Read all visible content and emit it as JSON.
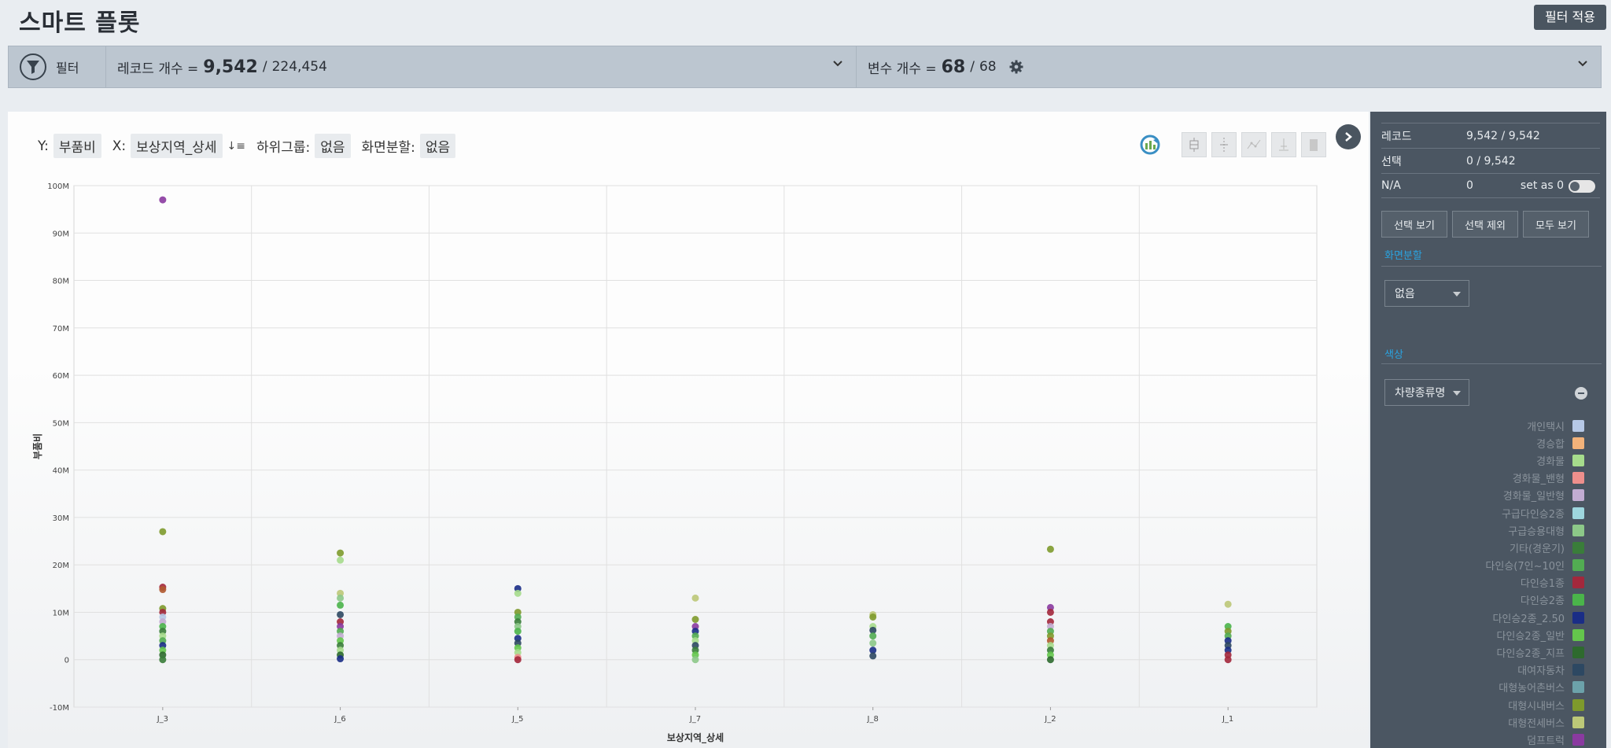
{
  "header": {
    "title": "스마트 플롯",
    "apply_button": "필터 적용"
  },
  "filterbar": {
    "filter_label": "필터",
    "records_label": "레코드 개수 =",
    "records_current": "9,542",
    "records_sep": "/",
    "records_total": "224,454",
    "vars_label": "변수 개수 =",
    "vars_current": "68",
    "vars_sep": "/",
    "vars_total": "68"
  },
  "plot_controls": {
    "y_label": "Y:",
    "y_value": "부품비",
    "x_label": "X:",
    "x_value": "보상지역_상세",
    "subgroup_label": "하위그룹:",
    "subgroup_value": "없음",
    "split_label": "화면분할:",
    "split_value": "없음"
  },
  "side_panel": {
    "rows": [
      {
        "key": "레코드",
        "value": "9,542 / 9,542"
      },
      {
        "key": "선택",
        "value": "0 / 9,542"
      },
      {
        "key": "N/A",
        "value": "0",
        "extra": "set as 0"
      }
    ],
    "buttons": [
      "선택 보기",
      "선택 제외",
      "모두 보기"
    ],
    "split_title": "화면분할",
    "split_value": "없음",
    "color_title": "색상",
    "color_value": "차량종류명",
    "legend": [
      {
        "name": "개인택시",
        "color": "#b6c8e6"
      },
      {
        "name": "경승합",
        "color": "#f2b27a"
      },
      {
        "name": "경화물",
        "color": "#a6dc8c"
      },
      {
        "name": "경화물_밴형",
        "color": "#ee8f8c"
      },
      {
        "name": "경화물_일반형",
        "color": "#c2acd2"
      },
      {
        "name": "구급다인승2종",
        "color": "#9ed6de"
      },
      {
        "name": "구급승용대형",
        "color": "#8cc888"
      },
      {
        "name": "기타(경운기)",
        "color": "#3a7d3a"
      },
      {
        "name": "다인승(7인~10인",
        "color": "#52ac52"
      },
      {
        "name": "다인승1종",
        "color": "#a3283c"
      },
      {
        "name": "다인승2종",
        "color": "#4ab44a"
      },
      {
        "name": "다인승2종_2.50",
        "color": "#1a2d86"
      },
      {
        "name": "다인승2종_일반",
        "color": "#64c64c"
      },
      {
        "name": "다인승2종_지프",
        "color": "#2e6a2e"
      },
      {
        "name": "대여자동차",
        "color": "#2d4862"
      },
      {
        "name": "대형농어촌버스",
        "color": "#6ca2aa"
      },
      {
        "name": "대형시내버스",
        "color": "#7e9a2c"
      },
      {
        "name": "대형전세버스",
        "color": "#bcc878"
      },
      {
        "name": "덤프트럭",
        "color": "#8a3aa0"
      }
    ]
  },
  "chart_data": {
    "type": "scatter",
    "title": "",
    "xlabel": "보상지역_상세",
    "ylabel": "부품비",
    "categories": [
      "J_3",
      "J_6",
      "J_5",
      "J_7",
      "J_8",
      "J_2",
      "J_1"
    ],
    "y_ticks": [
      "100M",
      "90M",
      "80M",
      "70M",
      "60M",
      "50M",
      "40M",
      "30M",
      "20M",
      "10M",
      "0",
      "-10M"
    ],
    "ylim": [
      -10000000,
      100000000
    ],
    "grid": true,
    "points": [
      {
        "x": "J_3",
        "y": 97000000,
        "color": "#8a3aa0"
      },
      {
        "x": "J_3",
        "y": 27000000,
        "color": "#7e9a2c"
      },
      {
        "x": "J_3",
        "y": 15300000,
        "color": "#a3283c"
      },
      {
        "x": "J_3",
        "y": 14800000,
        "color": "#b05a30"
      },
      {
        "x": "J_3",
        "y": 10800000,
        "color": "#7e9a2c"
      },
      {
        "x": "J_3",
        "y": 10000000,
        "color": "#a3283c"
      },
      {
        "x": "J_3",
        "y": 9000000,
        "color": "#b6c8e6"
      },
      {
        "x": "J_3",
        "y": 8000000,
        "color": "#c2acd2"
      },
      {
        "x": "J_3",
        "y": 7000000,
        "color": "#4ab44a"
      },
      {
        "x": "J_3",
        "y": 6000000,
        "color": "#3a7d3a"
      },
      {
        "x": "J_3",
        "y": 5000000,
        "color": "#a6dc8c"
      },
      {
        "x": "J_3",
        "y": 4000000,
        "color": "#52ac52"
      },
      {
        "x": "J_3",
        "y": 3000000,
        "color": "#1a2d86"
      },
      {
        "x": "J_3",
        "y": 2000000,
        "color": "#64c64c"
      },
      {
        "x": "J_3",
        "y": 1000000,
        "color": "#2e6a2e"
      },
      {
        "x": "J_3",
        "y": 0,
        "color": "#3a7d3a"
      },
      {
        "x": "J_6",
        "y": 22500000,
        "color": "#7e9a2c"
      },
      {
        "x": "J_6",
        "y": 21000000,
        "color": "#a6dc8c"
      },
      {
        "x": "J_6",
        "y": 14000000,
        "color": "#bcc878"
      },
      {
        "x": "J_6",
        "y": 13000000,
        "color": "#8cc888"
      },
      {
        "x": "J_6",
        "y": 11500000,
        "color": "#4ab44a"
      },
      {
        "x": "J_6",
        "y": 9500000,
        "color": "#2d4862"
      },
      {
        "x": "J_6",
        "y": 8000000,
        "color": "#a3283c"
      },
      {
        "x": "J_6",
        "y": 7000000,
        "color": "#8a3aa0"
      },
      {
        "x": "J_6",
        "y": 6000000,
        "color": "#52ac52"
      },
      {
        "x": "J_6",
        "y": 5000000,
        "color": "#c2acd2"
      },
      {
        "x": "J_6",
        "y": 4000000,
        "color": "#64c64c"
      },
      {
        "x": "J_6",
        "y": 3000000,
        "color": "#3a7d3a"
      },
      {
        "x": "J_6",
        "y": 2000000,
        "color": "#a6dc8c"
      },
      {
        "x": "J_6",
        "y": 1000000,
        "color": "#2e6a2e"
      },
      {
        "x": "J_6",
        "y": 200000,
        "color": "#1a2d86"
      },
      {
        "x": "J_5",
        "y": 15000000,
        "color": "#1a2d86"
      },
      {
        "x": "J_5",
        "y": 14000000,
        "color": "#a6dc8c"
      },
      {
        "x": "J_5",
        "y": 10000000,
        "color": "#7e9a2c"
      },
      {
        "x": "J_5",
        "y": 9000000,
        "color": "#52ac52"
      },
      {
        "x": "J_5",
        "y": 8000000,
        "color": "#3a7d3a"
      },
      {
        "x": "J_5",
        "y": 7000000,
        "color": "#8cc888"
      },
      {
        "x": "J_5",
        "y": 6000000,
        "color": "#4ab44a"
      },
      {
        "x": "J_5",
        "y": 4500000,
        "color": "#1a2d86"
      },
      {
        "x": "J_5",
        "y": 3500000,
        "color": "#2d4862"
      },
      {
        "x": "J_5",
        "y": 2500000,
        "color": "#64c64c"
      },
      {
        "x": "J_5",
        "y": 1500000,
        "color": "#a6dc8c"
      },
      {
        "x": "J_5",
        "y": 500000,
        "color": "#ee8f8c"
      },
      {
        "x": "J_5",
        "y": 0,
        "color": "#a3283c"
      },
      {
        "x": "J_7",
        "y": 13000000,
        "color": "#bcc878"
      },
      {
        "x": "J_7",
        "y": 8500000,
        "color": "#7e9a2c"
      },
      {
        "x": "J_7",
        "y": 7000000,
        "color": "#8a3aa0"
      },
      {
        "x": "J_7",
        "y": 6000000,
        "color": "#1a2d86"
      },
      {
        "x": "J_7",
        "y": 5000000,
        "color": "#52ac52"
      },
      {
        "x": "J_7",
        "y": 4000000,
        "color": "#a6dc8c"
      },
      {
        "x": "J_7",
        "y": 3000000,
        "color": "#2d4862"
      },
      {
        "x": "J_7",
        "y": 2000000,
        "color": "#3a7d3a"
      },
      {
        "x": "J_7",
        "y": 1000000,
        "color": "#64c64c"
      },
      {
        "x": "J_7",
        "y": 0,
        "color": "#8cc888"
      },
      {
        "x": "J_8",
        "y": 9500000,
        "color": "#bcc878"
      },
      {
        "x": "J_8",
        "y": 9000000,
        "color": "#7e9a2c"
      },
      {
        "x": "J_8",
        "y": 7000000,
        "color": "#a6dc8c"
      },
      {
        "x": "J_8",
        "y": 6200000,
        "color": "#2d4862"
      },
      {
        "x": "J_8",
        "y": 5000000,
        "color": "#52ac52"
      },
      {
        "x": "J_8",
        "y": 3500000,
        "color": "#8cc888"
      },
      {
        "x": "J_8",
        "y": 2000000,
        "color": "#1a2d86"
      },
      {
        "x": "J_8",
        "y": 800000,
        "color": "#2d4862"
      },
      {
        "x": "J_2",
        "y": 23300000,
        "color": "#7e9a2c"
      },
      {
        "x": "J_2",
        "y": 11000000,
        "color": "#8a3aa0"
      },
      {
        "x": "J_2",
        "y": 10000000,
        "color": "#a3283c"
      },
      {
        "x": "J_2",
        "y": 8000000,
        "color": "#a3283c"
      },
      {
        "x": "J_2",
        "y": 7000000,
        "color": "#c2acd2"
      },
      {
        "x": "J_2",
        "y": 6000000,
        "color": "#52ac52"
      },
      {
        "x": "J_2",
        "y": 5000000,
        "color": "#7e9a2c"
      },
      {
        "x": "J_2",
        "y": 4000000,
        "color": "#b05a30"
      },
      {
        "x": "J_2",
        "y": 3000000,
        "color": "#a6dc8c"
      },
      {
        "x": "J_2",
        "y": 2000000,
        "color": "#3a7d3a"
      },
      {
        "x": "J_2",
        "y": 1000000,
        "color": "#64c64c"
      },
      {
        "x": "J_2",
        "y": 0,
        "color": "#2e6a2e"
      },
      {
        "x": "J_1",
        "y": 11700000,
        "color": "#bcc878"
      },
      {
        "x": "J_1",
        "y": 7000000,
        "color": "#4ab44a"
      },
      {
        "x": "J_1",
        "y": 6000000,
        "color": "#7e9a2c"
      },
      {
        "x": "J_1",
        "y": 5000000,
        "color": "#52ac52"
      },
      {
        "x": "J_1",
        "y": 4000000,
        "color": "#1a2d86"
      },
      {
        "x": "J_1",
        "y": 3000000,
        "color": "#2d4862"
      },
      {
        "x": "J_1",
        "y": 2000000,
        "color": "#1a2d86"
      },
      {
        "x": "J_1",
        "y": 1000000,
        "color": "#a3283c"
      },
      {
        "x": "J_1",
        "y": 0,
        "color": "#a3283c"
      }
    ]
  }
}
